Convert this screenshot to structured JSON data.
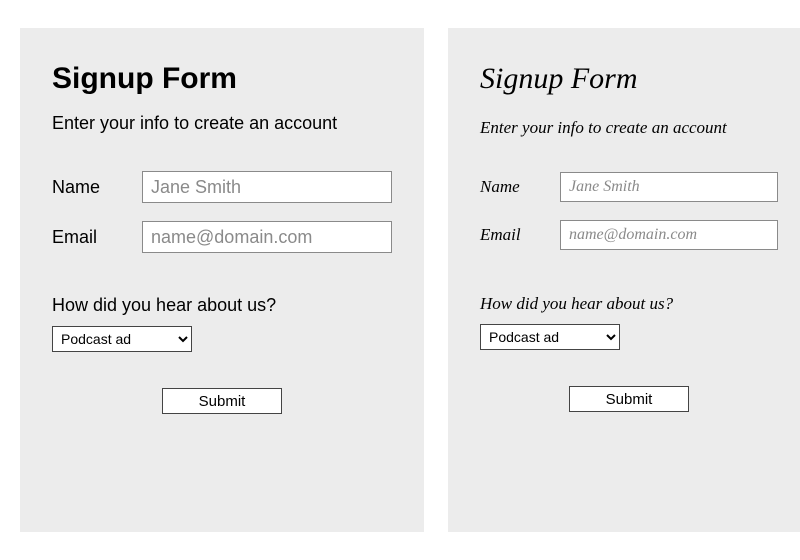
{
  "left": {
    "title": "Signup Form",
    "subtitle": "Enter your info to create an account",
    "name_label": "Name",
    "name_placeholder": "Jane Smith",
    "email_label": "Email",
    "email_placeholder": "name@domain.com",
    "question": "How did you hear about us?",
    "select_value": "Podcast ad",
    "submit_label": "Submit"
  },
  "right": {
    "title": "Signup Form",
    "subtitle": "Enter your info to create an account",
    "name_label": "Name",
    "name_placeholder": "Jane Smith",
    "email_label": "Email",
    "email_placeholder": "name@domain.com",
    "question": "How did you hear about us?",
    "select_value": "Podcast ad",
    "submit_label": "Submit"
  }
}
